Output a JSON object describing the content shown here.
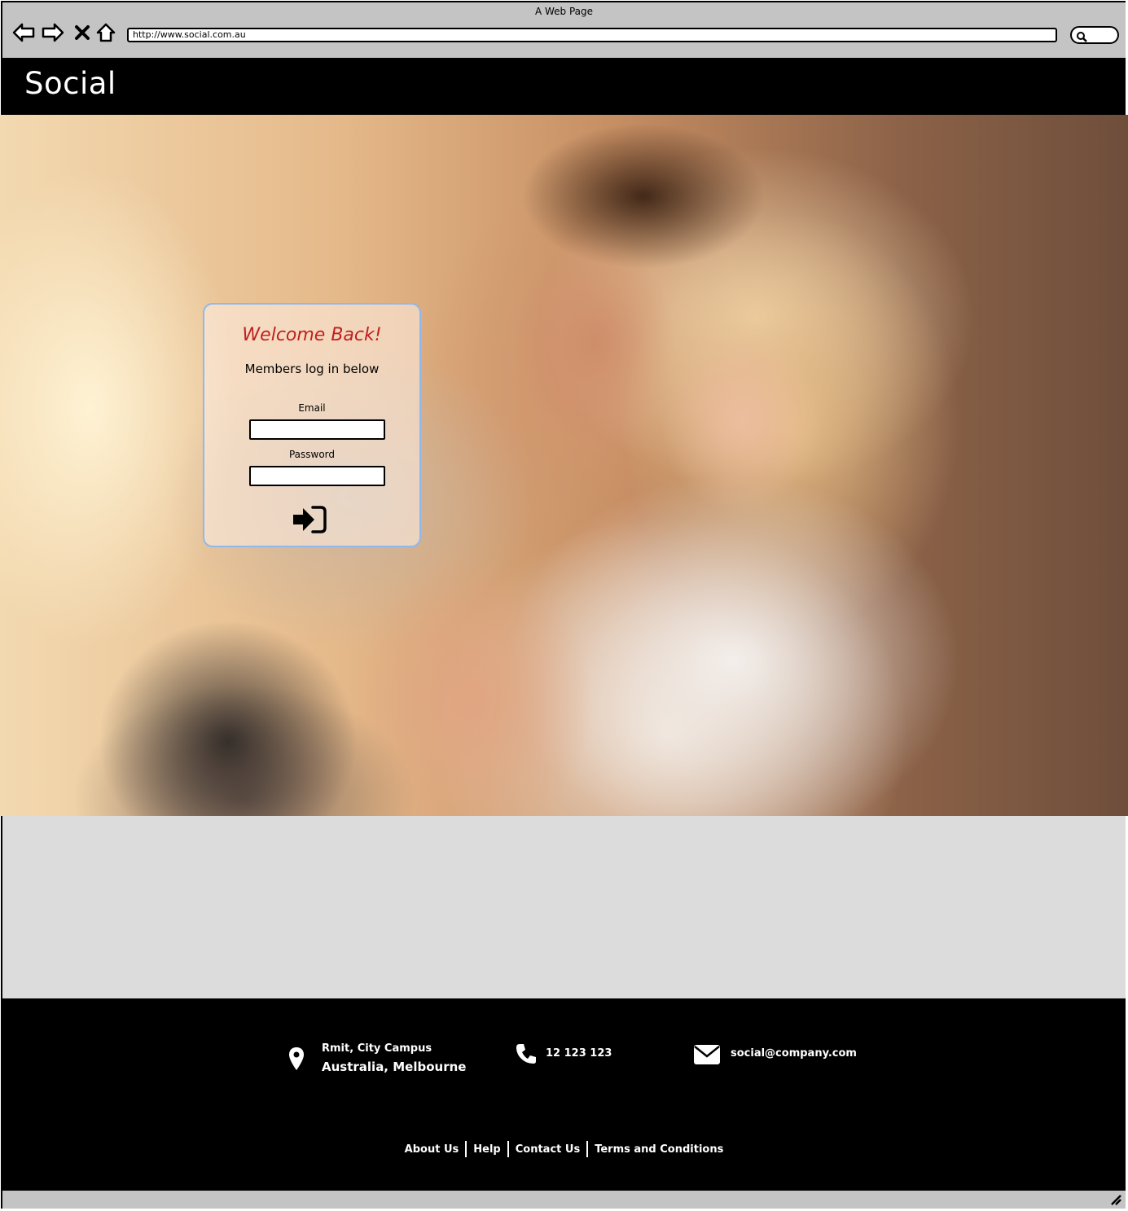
{
  "browser": {
    "window_title": "A Web Page",
    "url": "http://www.social.com.au"
  },
  "header": {
    "brand": "Social"
  },
  "login": {
    "title": "Welcome Back!",
    "subtitle": "Members log in below",
    "email_label": "Email",
    "password_label": "Password",
    "email_value": "",
    "password_value": ""
  },
  "footer": {
    "address_line1": "Rmit, City Campus",
    "address_line2": "Australia, Melbourne",
    "phone": "12 123 123",
    "email": "social@company.com",
    "links": [
      "About Us",
      "Help",
      "Contact Us",
      "Terms and Conditions"
    ]
  },
  "icons": {
    "back": "arrow-left-icon",
    "forward": "arrow-right-icon",
    "stop": "close-icon",
    "home": "home-icon",
    "search": "search-icon",
    "login": "sign-in-icon",
    "location": "map-pin-icon",
    "phone": "phone-icon",
    "mail": "envelope-icon",
    "resize": "resize-grip-icon"
  },
  "colors": {
    "header_bg": "#000000",
    "welcome_text": "#c22020",
    "card_border": "#8db9ee",
    "band_bg": "#dcdcdc"
  }
}
